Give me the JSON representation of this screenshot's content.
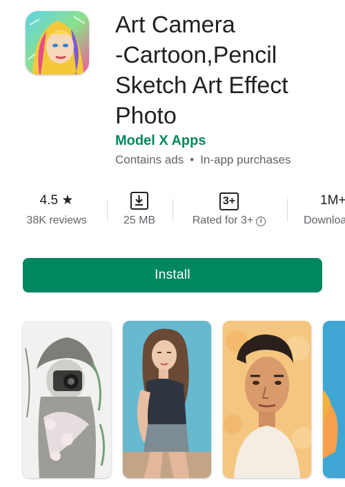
{
  "app": {
    "title": "Art Camera\n-Cartoon,Pencil\nSketch Art Effect\nPhoto",
    "developer": "Model X Apps",
    "contains_ads": "Contains ads",
    "in_app_purchases": "In-app purchases",
    "separator": "•",
    "icon": "app-icon-cartoon-portrait"
  },
  "stats": {
    "rating": "4.5",
    "rating_star": "★",
    "reviews": "38K reviews",
    "size": "25 MB",
    "content_rating_badge": "3+",
    "content_rating_label": "Rated for 3+",
    "info_glyph": "i",
    "downloads": "1M+",
    "downloads_label": "Downloads"
  },
  "install": {
    "label": "Install"
  },
  "screenshots": [
    {
      "alt": "pencil sketch photographer"
    },
    {
      "alt": "painted woman portrait"
    },
    {
      "alt": "cartoon man portrait"
    },
    {
      "alt": "partial screenshot"
    }
  ],
  "colors": {
    "accent": "#01875f",
    "text_primary": "#202124",
    "text_secondary": "#5f6368",
    "divider": "#dadce0"
  }
}
